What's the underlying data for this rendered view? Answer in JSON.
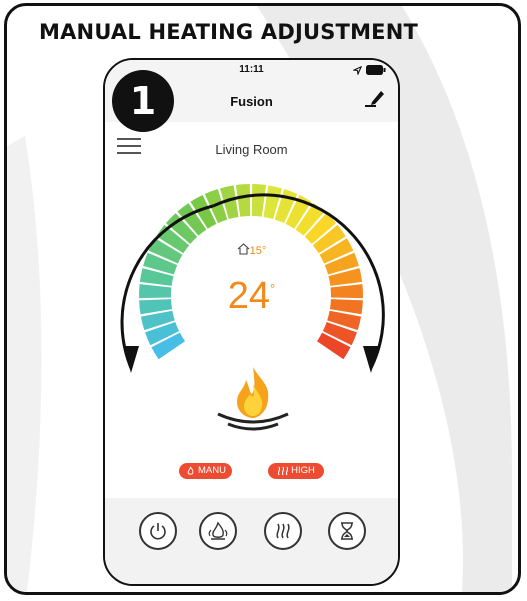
{
  "title": "MANUAL HEATING ADJUSTMENT",
  "step_badge": "1",
  "phone": {
    "status_time": "11:11",
    "app_title": "Fusion",
    "room_name": "Living Room",
    "target_temp": "15°",
    "current_temp": "24",
    "degree_symbol": "°",
    "mode_labels": {
      "mode": "MANU",
      "heat_level": "HIGH"
    },
    "bottom_buttons": [
      "power-icon",
      "flame-icon",
      "heat-waves-icon",
      "hourglass-icon"
    ]
  },
  "colors": {
    "accent_orange": "#f08a1c",
    "pill_red": "#ee4c32"
  }
}
